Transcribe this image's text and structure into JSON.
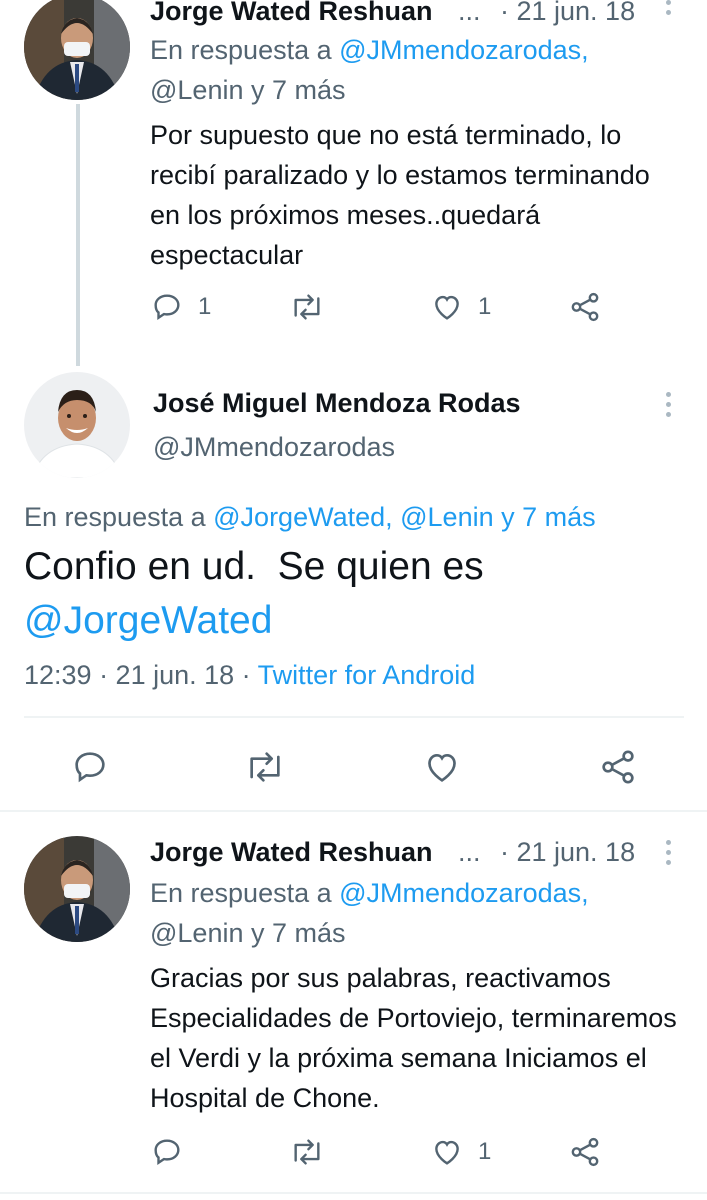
{
  "tweet1": {
    "name": "Jorge Wated Reshuan",
    "ellipsis": "...",
    "date": "· 21 jun. 18",
    "reply_prefix": "En respuesta a",
    "reply_mention_1": "@JMmendozarodas,",
    "reply_mention_2": "@Lenin y 7 más",
    "body": "Por supuesto que no está terminado, lo recibí paralizado y lo estamos terminando en los próximos meses..quedará espectacular",
    "replies": "1",
    "likes": "1"
  },
  "main_tweet": {
    "name": "José Miguel Mendoza Rodas",
    "handle": "@JMmendozarodas",
    "reply_prefix": "En respuesta a",
    "reply_mentions": "@JorgeWated, @Lenin y 7 más",
    "body_text": "Confio en ud.  Se quien es",
    "body_mention": "@JorgeWated",
    "time": "12:39 · 21 jun. 18 ·",
    "source": "Twitter for Android"
  },
  "tweet3": {
    "name": "Jorge Wated Reshuan",
    "ellipsis": "...",
    "date": "· 21 jun. 18",
    "reply_prefix": "En respuesta a",
    "reply_mention_1": "@JMmendozarodas,",
    "reply_mention_2": "@Lenin y 7 más",
    "body": "Gracias por sus palabras, reactivamos Especialidades de Portoviejo, terminaremos el Verdi y la próxima semana Iniciamos el Hospital de Chone.",
    "replies": "",
    "likes": "1"
  },
  "colors": {
    "link_blue": "#1d9bf0",
    "secondary_gray": "#536471",
    "text_dark": "#0f1419",
    "divider": "#eff3f4"
  },
  "icons": [
    "reply-icon",
    "retweet-icon",
    "like-icon",
    "share-icon",
    "more-icon"
  ]
}
